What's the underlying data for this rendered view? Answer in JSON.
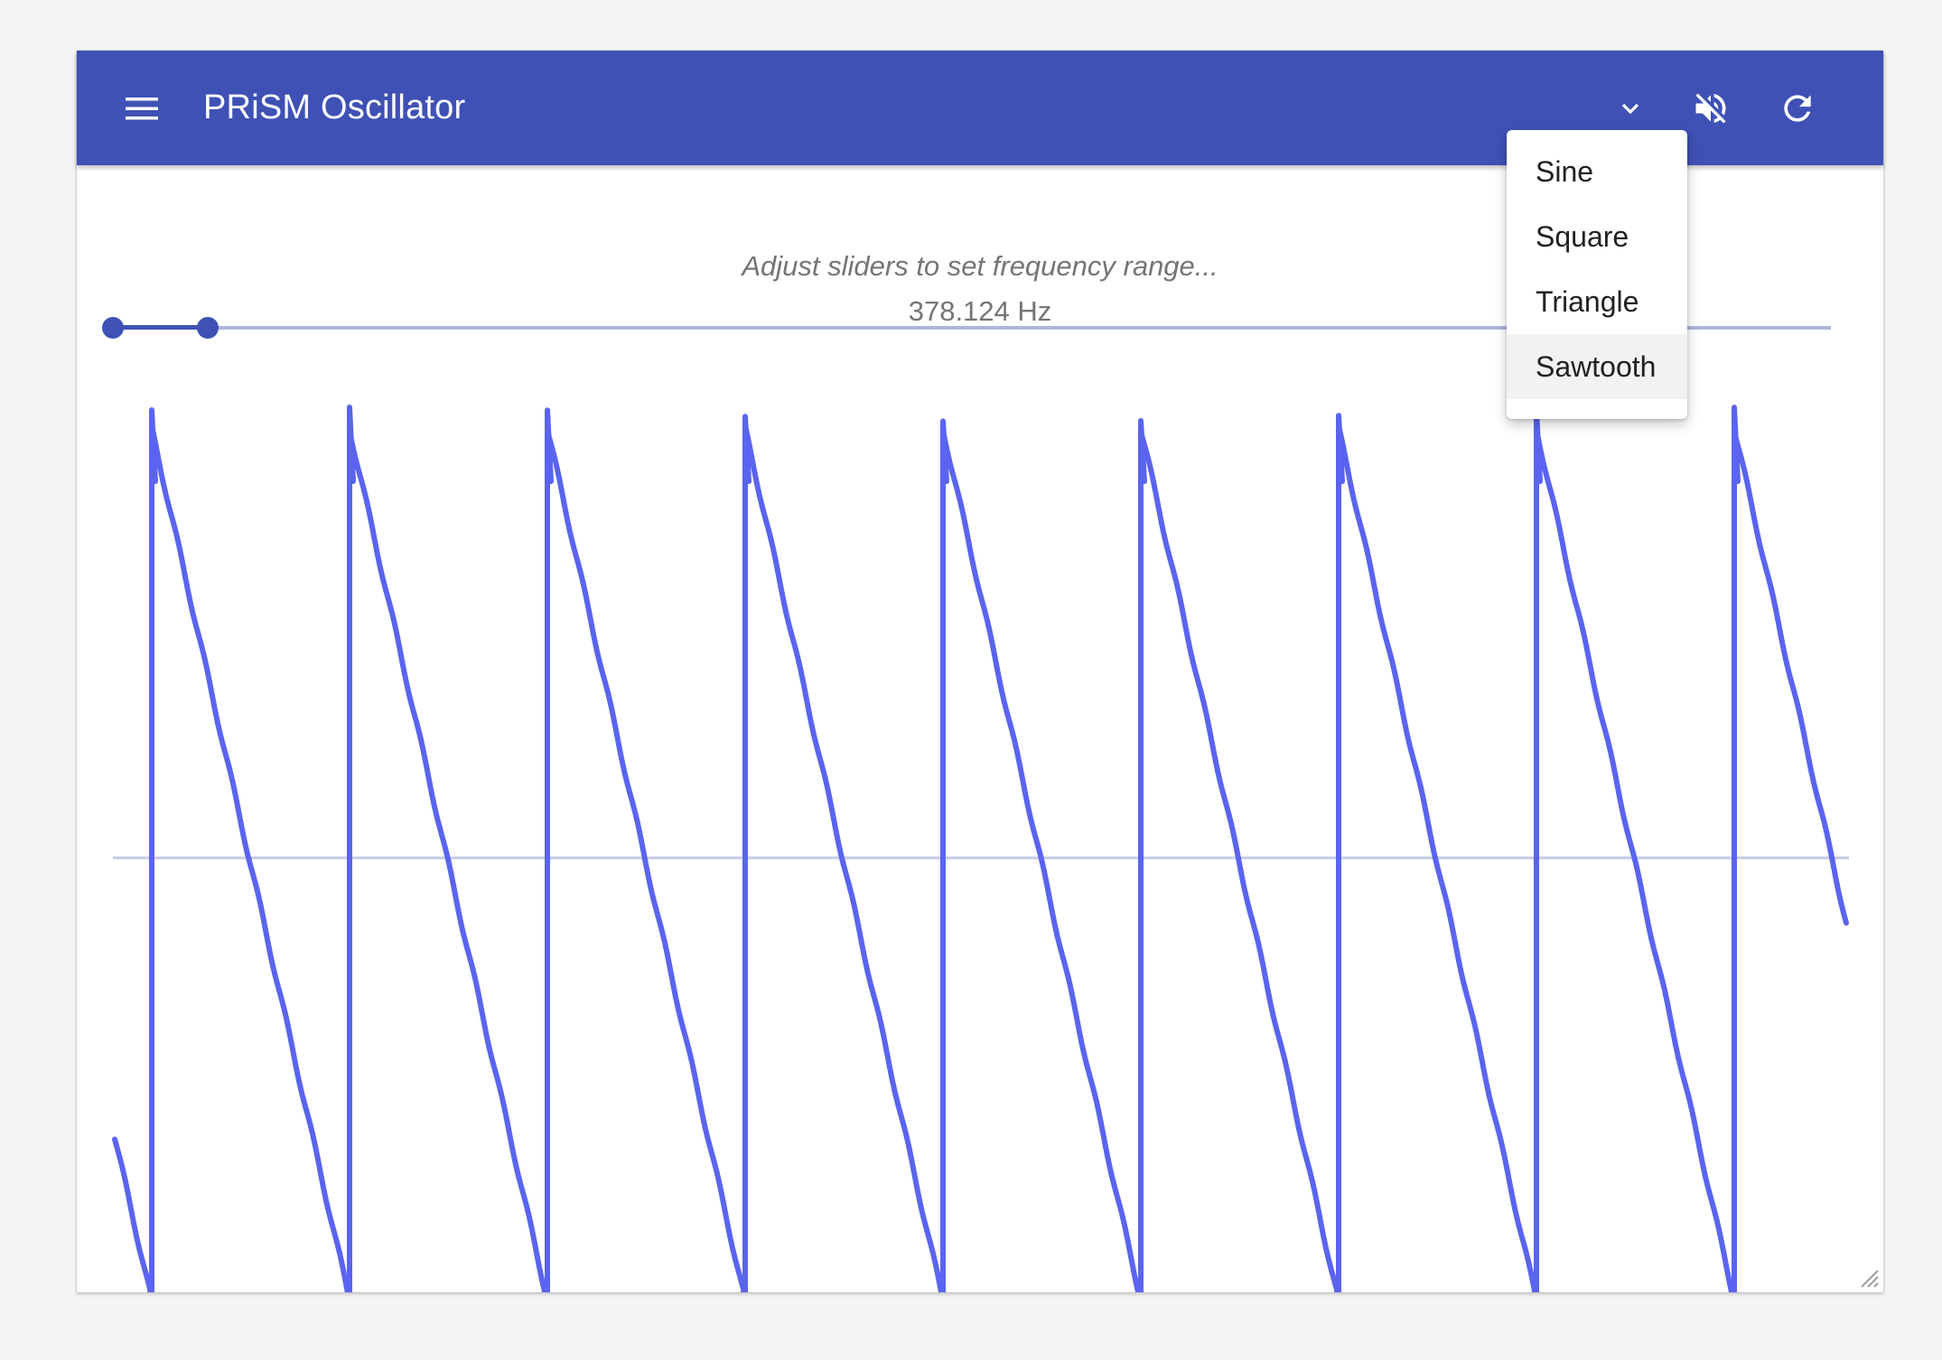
{
  "appbar": {
    "title": "PRiSM Oscillator",
    "background_color": "#3f51b5",
    "icons": {
      "menu": "hamburger-menu-icon",
      "select_arrow": "chevron-down-icon",
      "mute": "volume-off-icon",
      "refresh": "refresh-icon"
    }
  },
  "controls": {
    "hint": "Adjust sliders to set frequency range...",
    "frequency_display": "378.124 Hz"
  },
  "waveform_menu": {
    "options": [
      "Sine",
      "Square",
      "Triangle",
      "Sawtooth"
    ],
    "selected": "Sawtooth"
  },
  "waveform_display": {
    "type": "sawtooth",
    "trace_color": "#5a64f0",
    "zero_line_color": "#c5cae9"
  }
}
